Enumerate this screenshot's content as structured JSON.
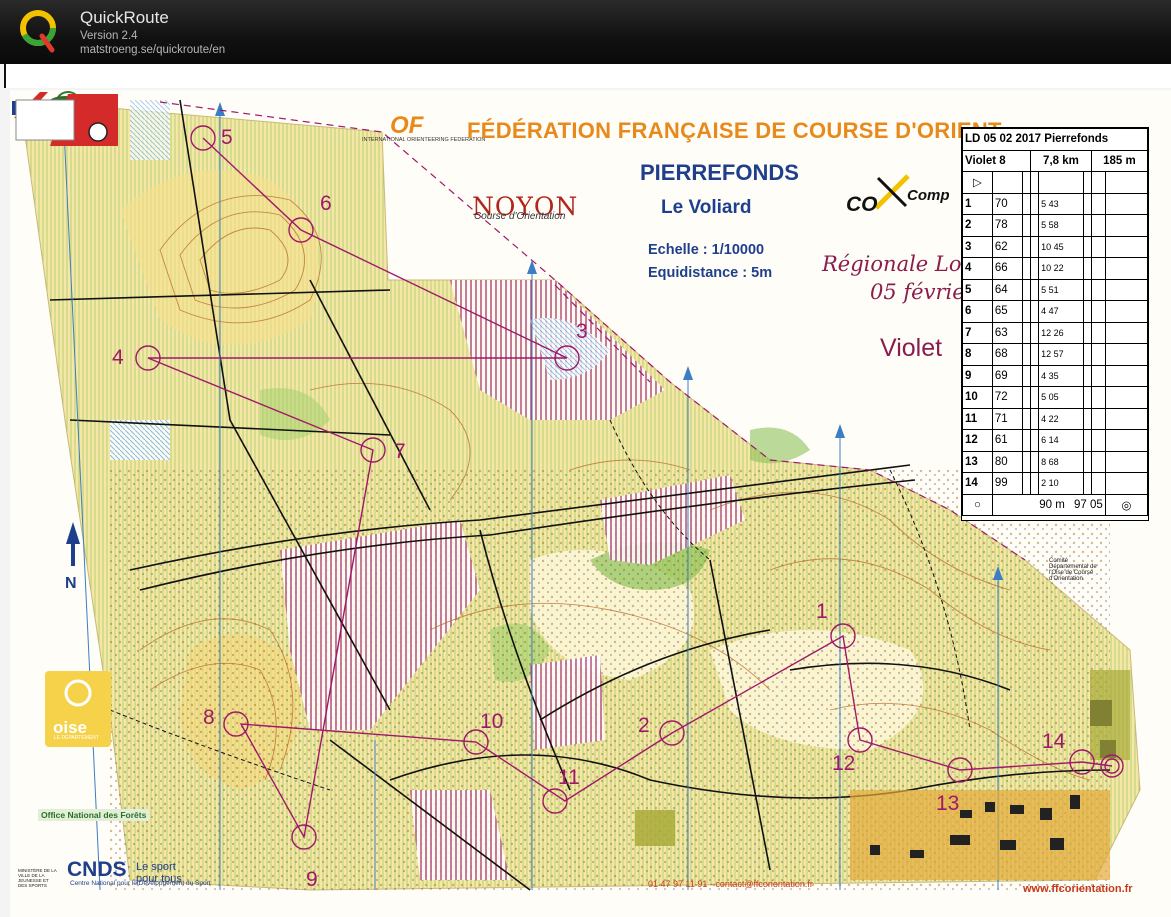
{
  "app": {
    "title": "QuickRoute",
    "version": "Version 2.4",
    "url": "matstroeng.se/quickroute/en"
  },
  "map": {
    "federation": "FÉDÉRATION FRANÇAISE DE COURSE D'ORIENT",
    "place": "PIERREFONDS",
    "area": "Le Voliard",
    "scale": "Echelle : 1/10000",
    "equidistance": "Equidistance : 5m",
    "regionale": "Régionale Long",
    "date": "05 févrie",
    "course": "Violet",
    "club_name": "NOYON",
    "club_sub": "Course d'Orientation",
    "iof": "OF",
    "iof_sub": "INTERNATIONAL ORIENTEERING FEDERATION",
    "sponsor_main": "CO",
    "sponsor_sub": "Comp",
    "oise": "oise",
    "oise_sub": "LE DÉPARTEMENT",
    "onf": "Office National des Forêts",
    "cnds": "CNDS",
    "cnds_sub": "Centre National pour le Développement du Sport",
    "sport_line1": "Le sport",
    "sport_line2": "pour tous",
    "ministere": "MINISTÈRE DE LA VILLE DE LA JEUNESSE ET DES SPORTS",
    "phone": "01 47 97 11 91 - contact@ffcorientation.fr",
    "website": "www.ffcorientation.fr",
    "comite": "Comité Départemental de l'Oise de Course d'Orientation",
    "control_numbers": [
      "1",
      "2",
      "3",
      "4",
      "5",
      "6",
      "7",
      "8",
      "9",
      "10",
      "11",
      "12",
      "13",
      "14"
    ]
  },
  "description_sheet": {
    "title": "LD 05 02 2017 Pierrefonds",
    "course": "Violet 8",
    "length": "7,8 km",
    "climb": "185 m",
    "rows": [
      {
        "num": "1",
        "code": "70",
        "feature": "5 43"
      },
      {
        "num": "2",
        "code": "78",
        "feature": "5 58"
      },
      {
        "num": "3",
        "code": "62",
        "feature": "10 45"
      },
      {
        "num": "4",
        "code": "66",
        "feature": "10 22"
      },
      {
        "num": "5",
        "code": "64",
        "feature": "5 51"
      },
      {
        "num": "6",
        "code": "65",
        "feature": "4 47"
      },
      {
        "num": "7",
        "code": "63",
        "feature": "12 26"
      },
      {
        "num": "8",
        "code": "68",
        "feature": "12 57"
      },
      {
        "num": "9",
        "code": "69",
        "feature": "4 35"
      },
      {
        "num": "10",
        "code": "72",
        "feature": "5 05"
      },
      {
        "num": "11",
        "code": "71",
        "feature": "4 22"
      },
      {
        "num": "12",
        "code": "61",
        "feature": "6 14"
      },
      {
        "num": "13",
        "code": "80",
        "feature": "8 68"
      },
      {
        "num": "14",
        "code": "99",
        "feature": "2 10"
      }
    ],
    "finish": "90 m",
    "finish_time": "97 05"
  },
  "colors": {
    "course_overprint": "#a0186a",
    "federation_orange": "#e8891c",
    "title_blue": "#1f3f8c",
    "olive_green": "#b9d77a",
    "open_yellow": "#f5e28a"
  }
}
